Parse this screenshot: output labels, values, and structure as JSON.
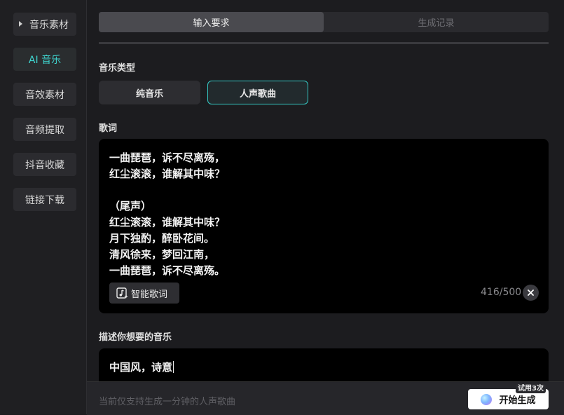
{
  "sidebar": {
    "items": [
      {
        "label": "音乐素材"
      },
      {
        "label": "AI 音乐"
      },
      {
        "label": "音效素材"
      },
      {
        "label": "音频提取"
      },
      {
        "label": "抖音收藏"
      },
      {
        "label": "链接下载"
      }
    ],
    "active_index": 1
  },
  "tabs": [
    {
      "label": "输入要求"
    },
    {
      "label": "生成记录"
    }
  ],
  "music_type": {
    "label": "音乐类型",
    "options": [
      "纯音乐",
      "人声歌曲"
    ],
    "selected": "人声歌曲"
  },
  "lyrics": {
    "label": "歌词",
    "text": "一曲琵琶，诉不尽离殇，\n红尘滚滚，谁解其中味？\n\n（尾声）\n红尘滚滚，谁解其中味？\n月下独酌，醉卧花间。\n清风徐来，梦回江南，\n一曲琵琶，诉不尽离殇。",
    "smart_button": "智能歌词",
    "count": "416/500"
  },
  "description": {
    "label": "描述你想要的音乐",
    "value": "中国风，诗意"
  },
  "footer": {
    "note": "当前仅支持生成一分钟的人声歌曲",
    "generate_button": "开始生成",
    "trial_badge": "试用3次"
  },
  "colors": {
    "accent": "#35c9c4",
    "background": "#1c1c1f",
    "input_bg": "#000000"
  }
}
